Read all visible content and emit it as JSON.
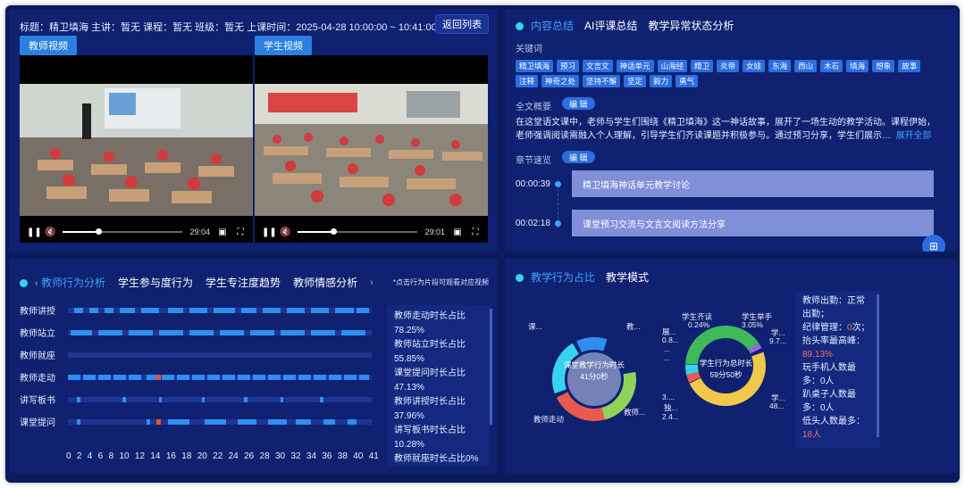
{
  "video_panel": {
    "header": "标题：精卫填海  主讲：暂无  课程：暂无  班级：暂无  上课时间：2025-04-28 10:00:00 ~ 10:41:00",
    "back_label": "返回列表",
    "teacher_label": "教师视频",
    "student_label": "学生视频",
    "teacher_time": "29:04",
    "student_time": "29:01",
    "teacher_progress": 0.3,
    "student_progress": 0.3
  },
  "summary_panel": {
    "tabs": [
      "内容总结",
      "AI评课总结",
      "教学异常状态分析"
    ],
    "keywords_label": "关键词",
    "keywords": [
      "精卫填海",
      "预习",
      "文言文",
      "神话单元",
      "山海经",
      "精卫",
      "炎帝",
      "女娃",
      "东海",
      "西山",
      "木石",
      "填海",
      "想象",
      "故事",
      "注释",
      "神奇之处",
      "坚持不懈",
      "坚定",
      "毅力",
      "勇气"
    ],
    "overview_label": "全文概要",
    "edit_label": "编 辑",
    "overview_text": "在这堂语文课中，老师与学生们围绕《精卫填海》这一神话故事，展开了一场生动的教学活动。课程伊始，老师强调阅读需融入个人理解，引导学生们齐读课题并积极参与。通过预习分享，学生们展示…",
    "expand_label": "展开全部",
    "chapters_label": "章节速览",
    "chapters": [
      {
        "time": "00:00:39",
        "title": "精卫填海神话单元教学讨论"
      },
      {
        "time": "00:02:18",
        "title": "课堂预习交流与文言文阅读方法分享"
      }
    ]
  },
  "behavior_panel": {
    "tabs": [
      "教师行为分析",
      "学生参与度行为",
      "学生专注度趋势",
      "教师情感分析"
    ],
    "hint": "*点击行为片段可观看对应视频",
    "rows": [
      "教师讲授",
      "教师站立",
      "教师就座",
      "教师走动",
      "讲写板书",
      "课堂提问"
    ],
    "axis": [
      "0",
      "2",
      "4",
      "6",
      "8",
      "10",
      "12",
      "14",
      "16",
      "18",
      "20",
      "22",
      "24",
      "26",
      "28",
      "30",
      "32",
      "34",
      "36",
      "38",
      "40",
      "41"
    ],
    "stats": [
      "教师走动时长占比",
      "78.25%",
      "教师站立时长占比",
      "55.85%",
      "课堂提问时长占比",
      "47.13%",
      "教师讲授时长占比",
      "37.96%",
      "讲写板书时长占比",
      "10.28%",
      "教师就座时长占比0%"
    ]
  },
  "ratio_panel": {
    "tabs": [
      "教学行为占比",
      "教学模式"
    ],
    "donut1": {
      "center_title": "课堂教学行为时长",
      "center_value": "41分0秒",
      "labels": [
        "课...",
        "教...",
        "教师走动",
        "教师..."
      ]
    },
    "donut2": {
      "center_title": "学生行为总时长",
      "center_value": "59分50秒",
      "labels": [
        "学生齐读",
        "0.24%",
        "学生举手",
        "3.05%",
        "学...",
        "9.7...",
        "展...",
        "0.8...",
        "...",
        "...",
        "3....",
        "独...",
        "2.4...",
        "学...",
        "48..."
      ]
    },
    "info": {
      "l1": "教师出勤：正常出勤；",
      "l2a": "纪律管理：",
      "l2b": "0",
      "l2c": "次；",
      "l3": "抬头率最高峰：",
      "l3v": "89.13%",
      "l4a": "玩手机人数最多：",
      "l4b": "0人",
      "l5a": "趴桌子人数最多：",
      "l5b": "0人",
      "l6": "低头人数最多：",
      "l6v": "18人"
    },
    "colors": {
      "accent": "#3ea2ff",
      "red": "#ff6b5b"
    }
  }
}
